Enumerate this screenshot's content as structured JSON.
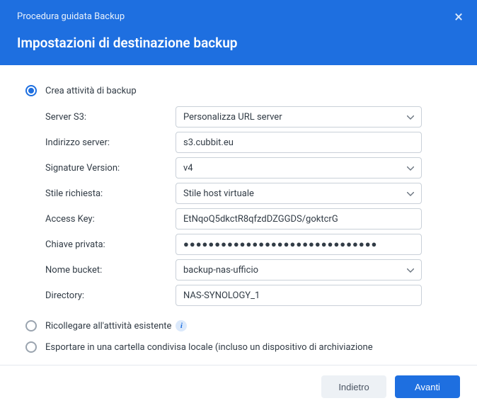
{
  "header": {
    "wizard_label": "Procedura guidata Backup",
    "title": "Impostazioni di destinazione backup"
  },
  "options": {
    "create": {
      "label": "Crea attività di backup",
      "selected": true
    },
    "relink": {
      "label": "Ricollegare all'attività esistente",
      "selected": false
    },
    "export_local": {
      "label": "Esportare in una cartella condivisa locale (incluso un dispositivo di archiviazione",
      "selected": false
    }
  },
  "form": {
    "server_s3": {
      "label": "Server S3:",
      "value": "Personalizza URL server"
    },
    "server_address": {
      "label": "Indirizzo server:",
      "value": "s3.cubbit.eu"
    },
    "signature_version": {
      "label": "Signature Version:",
      "value": "v4"
    },
    "request_style": {
      "label": "Stile richiesta:",
      "value": "Stile host virtuale"
    },
    "access_key": {
      "label": "Access Key:",
      "value": "EtNqoQ5dkctR8qfzdDZGGDS/goktcrG"
    },
    "private_key": {
      "label": "Chiave privata:",
      "value": "●●●●●●●●●●●●●●●●●●●●●●●●●●●●●●●"
    },
    "bucket_name": {
      "label": "Nome bucket:",
      "value": "backup-nas-ufficio"
    },
    "directory": {
      "label": "Directory:",
      "value": "NAS-SYNOLOGY_1"
    }
  },
  "footer": {
    "back": "Indietro",
    "next": "Avanti"
  }
}
